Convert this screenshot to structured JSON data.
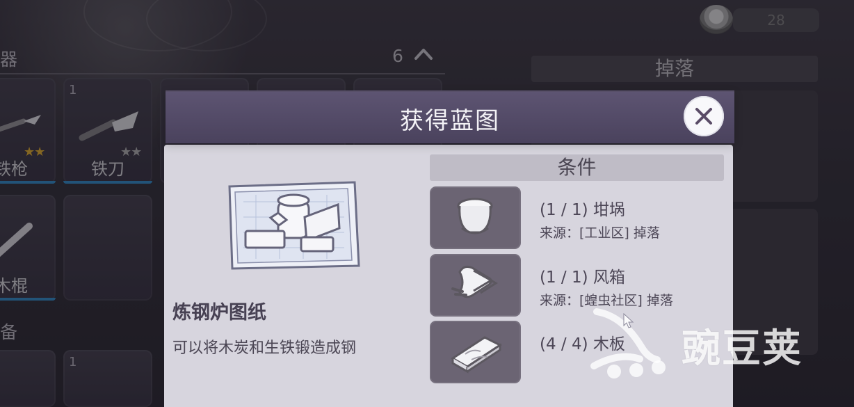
{
  "top_bar": {
    "currency_value": "28"
  },
  "left_panel": {
    "weapon_section_title": "器",
    "weapon_count": "6",
    "items": [
      {
        "number": "",
        "label": "铁枪",
        "stars": "★★",
        "star_style": "gold"
      },
      {
        "number": "1",
        "label": "铁刀",
        "stars": "★★",
        "star_style": "grey"
      },
      {
        "number": "",
        "label": "木棍",
        "stars": "",
        "star_style": ""
      }
    ],
    "bottom_section_title": "备",
    "bottom_item_number": "1"
  },
  "right_panel": {
    "drops_title": "掉落"
  },
  "modal": {
    "title": "获得蓝图",
    "blueprint_name": "炼钢炉图纸",
    "blueprint_desc": "可以将木炭和生铁锻造成钢",
    "conditions_title": "条件",
    "conditions": [
      {
        "count": "(1 / 1) 坩埚",
        "source": "来源：[工业区] 掉落",
        "icon_name": "crucible-icon"
      },
      {
        "count": "(1 / 1) 风箱",
        "source": "来源：[蝗虫社区] 掉落",
        "icon_name": "bellows-icon"
      },
      {
        "count": "(4 / 4) 木板",
        "source": "",
        "icon_name": "wood-plank-icon"
      }
    ]
  },
  "watermark": {
    "text": "豌豆荚"
  }
}
